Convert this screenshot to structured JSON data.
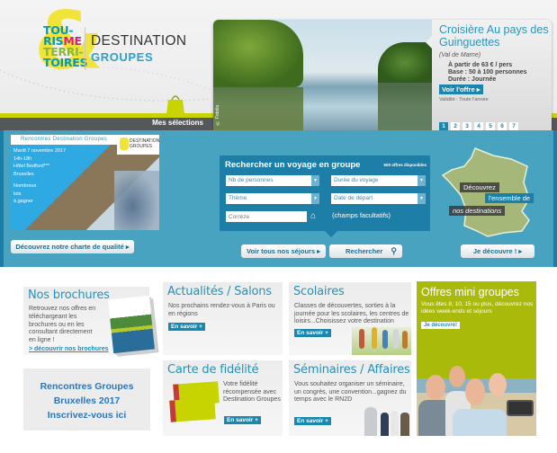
{
  "header": {
    "logo": {
      "line1": "TOU-",
      "line2a": "RIS",
      "line2b": "ME",
      "line3": "TERRI-",
      "line4": "TOIRES"
    },
    "brand_title": "DESTINATION",
    "brand_subtitle": "GROUPES",
    "my_selections": "Mes sélections"
  },
  "slideshow": {
    "title": "Croisière Au pays des Guinguettes",
    "region": "(Val de Marne)",
    "details": [
      "À partir de 63 € / pers",
      "Base : 50 à 100 personnes",
      "Durée : Journée"
    ],
    "cta": "Voir l'offre ▸",
    "validity": "Validité : Toute l'année",
    "photo_credit": "© Fotolia",
    "pages": [
      "1",
      "2",
      "3",
      "4",
      "5",
      "6",
      "7"
    ],
    "active_page": "1"
  },
  "promo": {
    "heading": "Rencontres Destination Groupes",
    "logo_text": "DESTINATION GROUPES",
    "lines": [
      "Mardi 7 novembre 2017",
      "14h-18h",
      "Hôtel Bedford***",
      "Bruxelles",
      "",
      "Nombreux",
      "lots",
      "à gagner"
    ],
    "quality_button": "Découvrez notre charte de qualité ▸"
  },
  "search": {
    "title": "Rechercher un voyage en groupe",
    "count": "500 offres disponibles",
    "fields": {
      "people": "Nb de personnes",
      "duration": "Durée du voyage",
      "theme": "Thème",
      "departure": "Date de départ",
      "region_placeholder": "Corrèze"
    },
    "optional_note": "(champs facultatifs)",
    "all_trips_button": "Voir tous nos séjours ▸",
    "search_button": "Rechercher"
  },
  "map": {
    "label1": "Découvrez",
    "label2": "l'ensemble de",
    "label3": "nos destinations",
    "button": "Je découvre ! ▸"
  },
  "brochures": {
    "title": "Nos brochures",
    "text": "Retrouvez nos offres en téléchargeant les brochures ou en les consultant directement en ligne !",
    "link": "> découvrir nos brochures"
  },
  "rencontres": {
    "lines": [
      "Rencontres Groupes",
      "Bruxelles 2017",
      "Inscrivez-vous ici"
    ]
  },
  "cards": {
    "news": {
      "title": "Actualités / Salons",
      "text": "Nos prochains rendez-vous à Paris ou en régions",
      "button": "En savoir +"
    },
    "schools": {
      "title": "Scolaires",
      "text": "Classes de découvertes, sorties à la journée pour les scolaires, les centres de loisirs...Choisissez votre destination",
      "button": "En savoir +"
    },
    "loyalty": {
      "title": "Carte de fidélité",
      "text": "Votre fidélité récompensée avec Destination Groupes",
      "button": "En savoir +"
    },
    "seminars": {
      "title": "Séminaires / Affaires",
      "text": "Vous souhaitez organiser un séminaire, un congrès, une convention...gagnez du temps avec le RN2D",
      "button": "En savoir +"
    }
  },
  "mini_groups": {
    "title": "Offres mini groupes",
    "text": "Vous êtes 8, 10, 15 ou plus, découvrez nos idées week-ends et séjours",
    "button": "Je découvre!"
  },
  "colors": {
    "accent_blue": "#1b85ad",
    "band_blue": "#47a3bf",
    "lime": "#c8d400",
    "olive": "#a9ba0a",
    "dark_bar": "#55585a"
  }
}
